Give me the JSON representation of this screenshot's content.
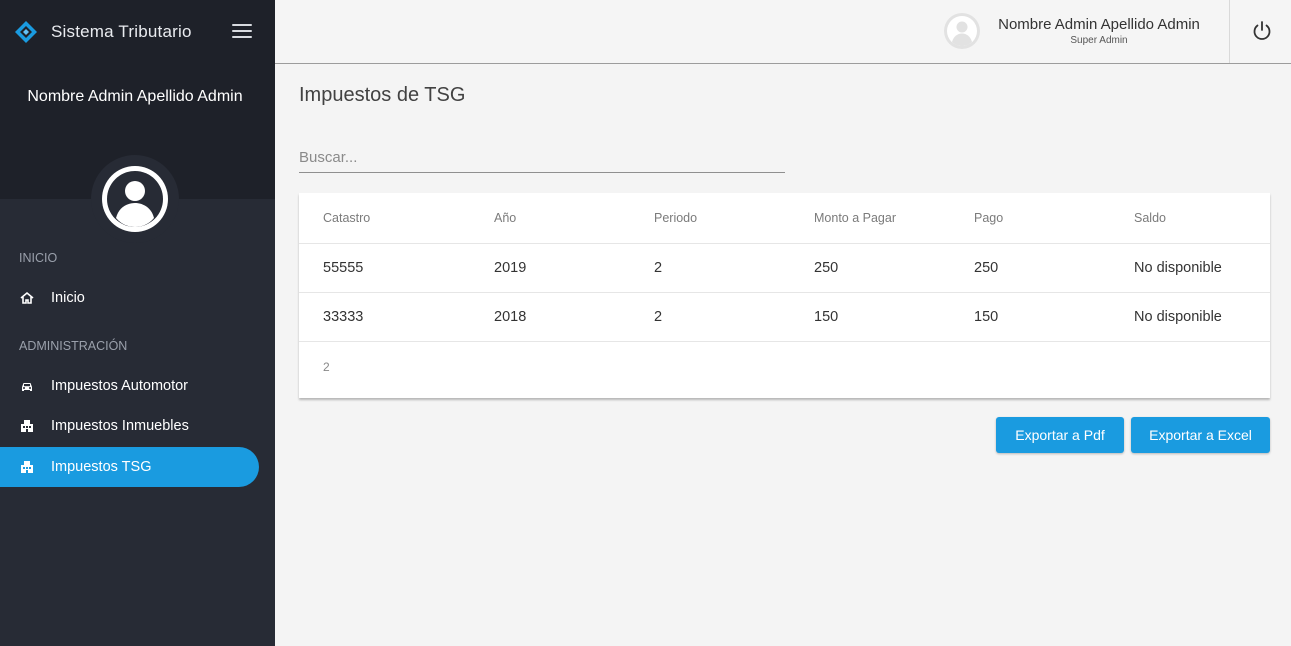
{
  "app": {
    "title": "Sistema Tributario",
    "accent_color": "#1a9be0",
    "sidebar_color": "#272b35"
  },
  "sidebar": {
    "user_name": "Nombre Admin Apellido Admin",
    "sections": [
      {
        "title": "INICIO",
        "items": [
          {
            "label": "Inicio",
            "icon": "home-icon"
          }
        ]
      },
      {
        "title": "ADMINISTRACIÓN",
        "items": [
          {
            "label": "Impuestos Automotor",
            "icon": "car-icon"
          },
          {
            "label": "Impuestos Inmuebles",
            "icon": "building-icon"
          },
          {
            "label": "Impuestos TSG",
            "icon": "building-icon",
            "active": true
          }
        ]
      }
    ]
  },
  "header": {
    "user_name": "Nombre Admin Apellido Admin",
    "user_role": "Super Admin",
    "logout_icon": "power-icon"
  },
  "main": {
    "title": "Impuestos de TSG",
    "search": {
      "placeholder": "Buscar...",
      "value": ""
    },
    "table": {
      "columns": [
        "Catastro",
        "Año",
        "Periodo",
        "Monto a Pagar",
        "Pago",
        "Saldo"
      ],
      "rows": [
        [
          "55555",
          "2019",
          "2",
          "250",
          "250",
          "No disponible"
        ],
        [
          "33333",
          "2018",
          "2",
          "150",
          "150",
          "No disponible"
        ]
      ],
      "footer": "2"
    },
    "buttons": {
      "export_pdf": "Exportar a Pdf",
      "export_excel": "Exportar a Excel"
    }
  }
}
